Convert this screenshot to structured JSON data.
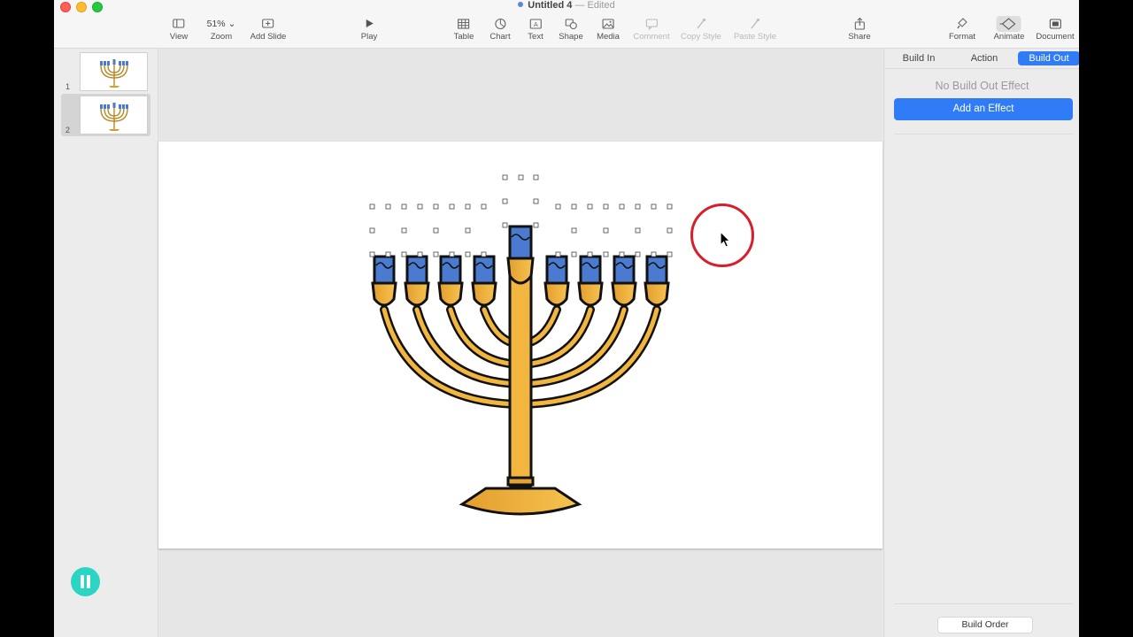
{
  "window": {
    "title": "Untitled 4",
    "separator": "—",
    "status": "Edited"
  },
  "toolbar": {
    "view": "View",
    "zoom_value": "51%",
    "zoom": "Zoom",
    "add_slide": "Add Slide",
    "play": "Play",
    "table": "Table",
    "chart": "Chart",
    "text": "Text",
    "shape": "Shape",
    "media": "Media",
    "comment": "Comment",
    "copy_style": "Copy Style",
    "paste_style": "Paste Style",
    "share": "Share",
    "format": "Format",
    "animate": "Animate",
    "document": "Document"
  },
  "navigator": {
    "slides": [
      {
        "number": "1"
      },
      {
        "number": "2"
      }
    ]
  },
  "inspector": {
    "tabs": [
      "Build In",
      "Action",
      "Build Out"
    ],
    "active_tab": "Build Out",
    "no_effect": "No Build Out Effect",
    "add_effect": "Add an Effect",
    "build_order": "Build Order"
  },
  "colors": {
    "accent": "#2f7cf6",
    "candle": "#4a7bd0",
    "gold": "#f2b640",
    "highlight_ring": "#d71f2a",
    "pause": "#2bd5c4"
  }
}
